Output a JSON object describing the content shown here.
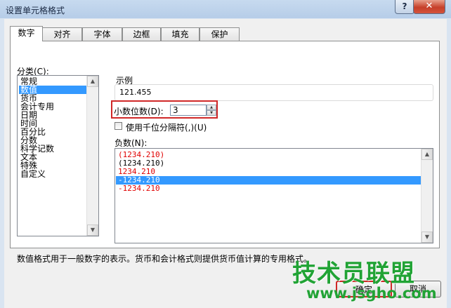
{
  "window": {
    "title": "设置单元格格式",
    "help_glyph": "?",
    "close_glyph": "✕"
  },
  "tabs": [
    {
      "label": "数字",
      "active": true
    },
    {
      "label": "对齐"
    },
    {
      "label": "字体"
    },
    {
      "label": "边框"
    },
    {
      "label": "填充"
    },
    {
      "label": "保护"
    }
  ],
  "category": {
    "label": "分类(C):",
    "items": [
      "常规",
      "数值",
      "货币",
      "会计专用",
      "日期",
      "时间",
      "百分比",
      "分数",
      "科学记数",
      "文本",
      "特殊",
      "自定义"
    ],
    "selected": "数值"
  },
  "sample": {
    "label": "示例",
    "value": "121.455"
  },
  "decimal": {
    "label": "小数位数(D):",
    "value": "3"
  },
  "thousands": {
    "label": "使用千位分隔符(,)(U)",
    "checked": false
  },
  "negative": {
    "label": "负数(N):",
    "items": [
      {
        "text": "(1234.210)",
        "color": "#e00000"
      },
      {
        "text": "(1234.210)",
        "color": "#000000"
      },
      {
        "text": "1234.210",
        "color": "#e00000"
      },
      {
        "text": "-1234.210",
        "color": "#000000",
        "selected": true
      },
      {
        "text": "-1234.210",
        "color": "#e00000"
      }
    ]
  },
  "description": "数值格式用于一般数字的表示。货币和会计格式则提供货币值计算的专用格式。",
  "buttons": {
    "ok": "确定",
    "cancel": "取消"
  },
  "watermark": {
    "text": "技术员联盟",
    "url": "www.jsgho.com"
  },
  "colors": {
    "selection": "#3399ff",
    "highlight_frame": "#d02828",
    "negative_red": "#e00000",
    "watermark": "#21a335"
  }
}
